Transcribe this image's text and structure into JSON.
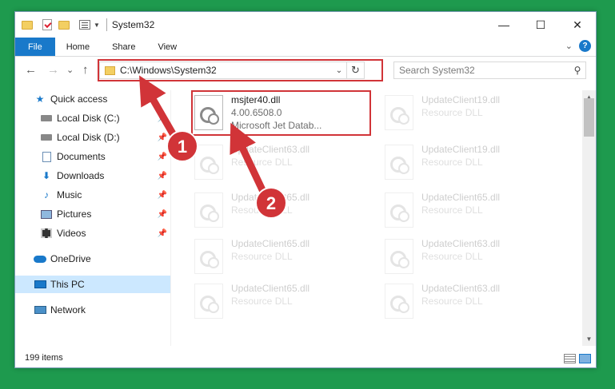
{
  "window": {
    "title": "System32",
    "controls": {
      "minimize": "—",
      "maximize": "☐",
      "close": "✕"
    }
  },
  "ribbon": {
    "tabs": [
      "File",
      "Home",
      "Share",
      "View"
    ],
    "collapse_glyph": "⌄",
    "help_glyph": "?"
  },
  "navigation": {
    "back": "←",
    "forward": "→",
    "recent": "⌄",
    "up": "↑",
    "address": "C:\\Windows\\System32",
    "address_dropdown": "⌄",
    "refresh": "↻",
    "search_placeholder": "Search System32",
    "search_glyph": "⚲"
  },
  "sidebar": {
    "items": [
      {
        "label": "Quick access",
        "icon": "star-icon"
      },
      {
        "label": "Local Disk (C:)",
        "icon": "disk-icon",
        "pinned": true
      },
      {
        "label": "Local Disk (D:)",
        "icon": "disk-icon",
        "pinned": true
      },
      {
        "label": "Documents",
        "icon": "documents-icon",
        "pinned": true
      },
      {
        "label": "Downloads",
        "icon": "download-icon",
        "pinned": true
      },
      {
        "label": "Music",
        "icon": "music-icon",
        "pinned": true
      },
      {
        "label": "Pictures",
        "icon": "pictures-icon",
        "pinned": true
      },
      {
        "label": "Videos",
        "icon": "videos-icon",
        "pinned": true
      },
      {
        "label": "OneDrive",
        "icon": "cloud-icon"
      },
      {
        "label": "This PC",
        "icon": "computer-icon",
        "selected": true
      },
      {
        "label": "Network",
        "icon": "network-icon"
      }
    ],
    "pin_glyph": "📌"
  },
  "files": {
    "highlighted": {
      "name": "msjter40.dll",
      "line2": "4.00.6508.0",
      "line3": "Microsoft Jet Datab..."
    },
    "faded": [
      {
        "name": "UpdateClient19.dll",
        "type": "Resource DLL"
      },
      {
        "name": "UpdateClient63.dll",
        "type": "Resource DLL"
      },
      {
        "name": "UpdateClient19.dll",
        "type": "Resource DLL"
      },
      {
        "name": "UpdateClient65.dll",
        "type": "Resource DLL"
      },
      {
        "name": "UpdateClient65.dll",
        "type": "Resource DLL"
      },
      {
        "name": "UpdateClient65.dll",
        "type": "Resource DLL"
      },
      {
        "name": "UpdateClient63.dll",
        "type": "Resource DLL"
      },
      {
        "name": "UpdateClient65.dll",
        "type": "Resource DLL"
      },
      {
        "name": "UpdateClient63.dll",
        "type": "Resource DLL"
      }
    ]
  },
  "status": {
    "item_count": "199 items"
  },
  "annotations": {
    "step1": "1",
    "step2": "2",
    "color": "#d13438"
  }
}
